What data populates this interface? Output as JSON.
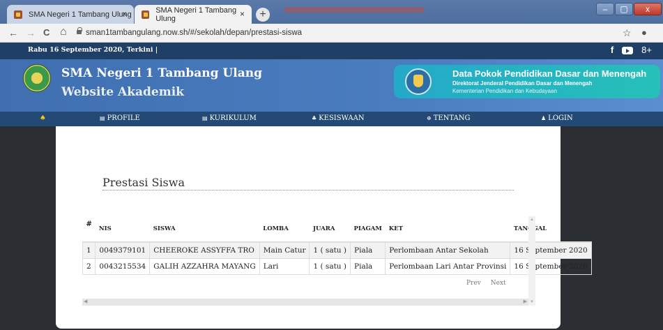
{
  "browser": {
    "tabs": [
      {
        "title": "SMA Negeri 1 Tambang Ulung",
        "close": "×"
      },
      {
        "title": "SMA Negeri 1 Tambang Ulung",
        "close": "×"
      }
    ],
    "new_tab": "+",
    "url": "sman1tambangulang.now.sh/#/sekolah/depan/prestasi-siswa",
    "window_controls": {
      "minimize": "–",
      "maximize": "▢",
      "close": "x"
    },
    "nav": {
      "back": "←",
      "forward": "→",
      "reload": "C",
      "home": "⌂",
      "star": "☆",
      "account": "●"
    }
  },
  "header": {
    "date_text": "Rabu 16 September 2020, Terkini |",
    "social": {
      "facebook": "f",
      "googleplus": "8+"
    },
    "school_name": "SMA Negeri 1 Tambang Ulang",
    "site_subtitle": "Website Akademik",
    "dapo": {
      "title": "Data Pokok Pendidikan Dasar dan Menengah",
      "line2": "Direktorat Jenderal Pendidikan Dasar dan Menengah",
      "line3": "Kementerian Pendidikan dan Kebudayaan"
    }
  },
  "navbar": {
    "home_icon": "♠",
    "items": [
      {
        "icon": "▤",
        "label": "PROFILE"
      },
      {
        "icon": "▤",
        "label": "KURIKULUM"
      },
      {
        "icon": "♣",
        "label": "KESISWAAN"
      },
      {
        "icon": "⊕",
        "label": "TENTANG"
      },
      {
        "icon": "♟",
        "label": "LOGIN"
      }
    ]
  },
  "main": {
    "heading": "Prestasi Siswa",
    "table": {
      "columns": [
        "#",
        "NIS",
        "SISWA",
        "LOMBA",
        "JUARA",
        "PIAGAM",
        "KET",
        "TANGGAL"
      ],
      "rows": [
        [
          "1",
          "0049379101",
          "CHEEROKE ASSYFFA TRO",
          "Main Catur",
          "1 ( satu )",
          "Piala",
          "Perlombaan Antar Sekolah",
          "16 September 2020"
        ],
        [
          "2",
          "0043215534",
          "GALIH AZZAHRA MAYANG",
          "Lari",
          "1 ( satu )",
          "Piala",
          "Perlombaan Lari Antar Provinsi",
          "16 September 2020"
        ]
      ]
    },
    "pager": {
      "prev": "Prev",
      "next": "Next"
    }
  }
}
